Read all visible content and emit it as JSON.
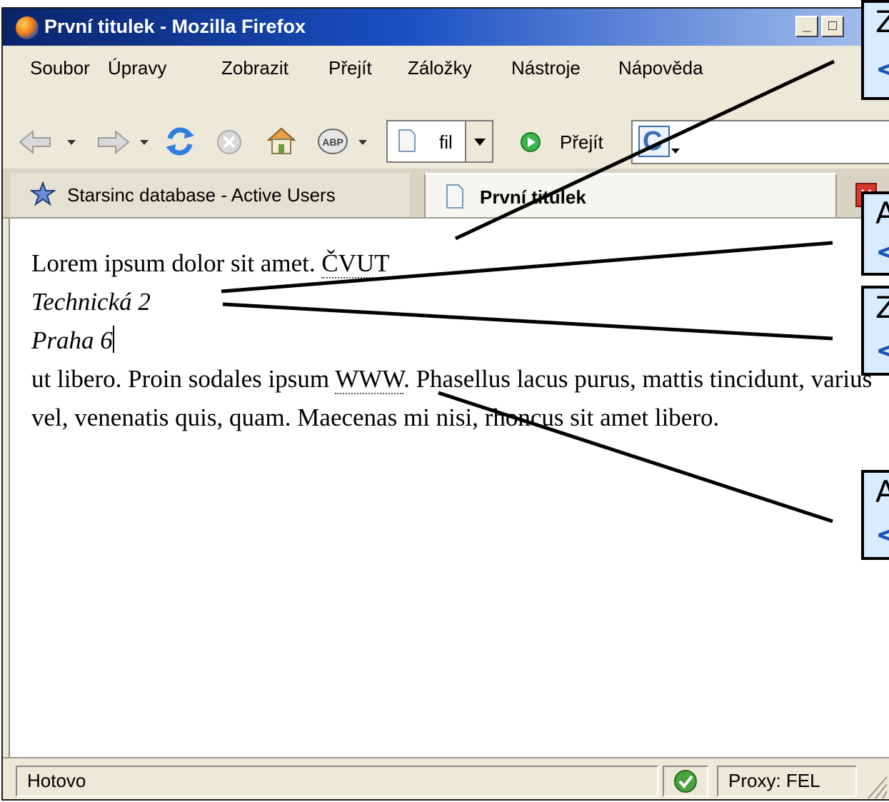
{
  "window": {
    "title": "První titulek - Mozilla Firefox",
    "controls": {
      "minimize": "_",
      "maximize": "□"
    }
  },
  "slide_header_fragment": "",
  "menu": [
    "Soubor",
    "Úpravy",
    "Zobrazit",
    "Přejít",
    "Záložky",
    "Nástroje",
    "Nápověda"
  ],
  "toolbar": {
    "url_value": "fil",
    "go_label": "Přejít",
    "search_engine_letter": "C",
    "abp_label": "ABP"
  },
  "tabs": [
    {
      "label": "Starsinc database - Active Users",
      "active": false
    },
    {
      "label": "První titulek",
      "active": true
    }
  ],
  "content": {
    "line1_text": "Lorem ipsum dolor sit amet. ",
    "line1_abbr": "ČVUT",
    "address_line1": "Technická 2",
    "address_line2": "Praha 6",
    "para_start": "ut libero. Proin sodales ipsum ",
    "para_abbr": "WWW",
    "para_rest": ". Phasellus lacus purus, mattis tincidunt, varius vel, venenatis quis, quam. Maecenas mi nisi, rhoncus sit amet libero."
  },
  "status": {
    "text": "Hotovo",
    "proxy": "Proxy: FEL"
  },
  "callouts": [
    {
      "line1": "Z",
      "line2": "<"
    },
    {
      "line1": "A",
      "line2": "<"
    },
    {
      "line1": "Z",
      "line2": "<"
    },
    {
      "line1": "A",
      "line2": "<"
    }
  ],
  "colors": {
    "titlebar_start": "#0a246a",
    "titlebar_end": "#a8c2ee",
    "chrome": "#ece9d8",
    "callout_fill": "#d8ecff",
    "callout_accent": "#1a55b8"
  }
}
